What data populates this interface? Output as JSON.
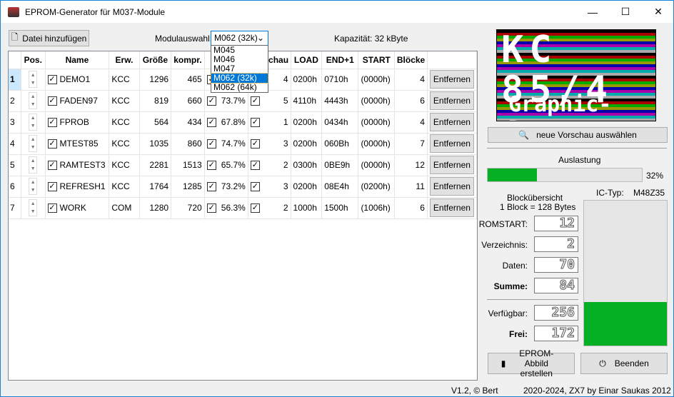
{
  "window": {
    "title": "EPROM-Generator für M037-Module",
    "minimize": "—",
    "maximize": "☐",
    "close": "✕"
  },
  "toolbar": {
    "add_file": "Datei hinzufügen",
    "module_label": "Modulauswahl:",
    "module_value": "M062 (32k)",
    "module_options": [
      "M045",
      "M046",
      "M047",
      "M062 (32k)",
      "M062 (64k)"
    ],
    "capacity": "Kapazität:  32 kByte"
  },
  "table": {
    "headers": [
      "Pos.",
      "Name",
      "Erw.",
      "Größe",
      "kompr.",
      "",
      "Vorschau",
      "LOAD",
      "END+1",
      "START",
      "Blöcke"
    ],
    "rows": [
      {
        "n": "1",
        "name": "DEMO1",
        "ext": "KCC",
        "size": "1296",
        "comp": "465",
        "pct": "",
        "pv": "4",
        "load": "0200h",
        "end": "0710h",
        "start": "(0000h)",
        "blocks": "4"
      },
      {
        "n": "2",
        "name": "FADEN97",
        "ext": "KCC",
        "size": "819",
        "comp": "660",
        "pct": "73.7%",
        "pv": "5",
        "load": "4110h",
        "end": "4443h",
        "start": "(0000h)",
        "blocks": "6"
      },
      {
        "n": "3",
        "name": "FPROB",
        "ext": "KCC",
        "size": "564",
        "comp": "434",
        "pct": "67.8%",
        "pv": "1",
        "load": "0200h",
        "end": "0434h",
        "start": "(0000h)",
        "blocks": "4"
      },
      {
        "n": "4",
        "name": "MTEST85",
        "ext": "KCC",
        "size": "1035",
        "comp": "860",
        "pct": "74.7%",
        "pv": "3",
        "load": "0200h",
        "end": "060Bh",
        "start": "(0000h)",
        "blocks": "7"
      },
      {
        "n": "5",
        "name": "RAMTEST3",
        "ext": "KCC",
        "size": "2281",
        "comp": "1513",
        "pct": "65.7%",
        "pv": "2",
        "load": "0300h",
        "end": "0BE9h",
        "start": "(0000h)",
        "blocks": "12"
      },
      {
        "n": "6",
        "name": "REFRESH1",
        "ext": "KCC",
        "size": "1764",
        "comp": "1285",
        "pct": "73.2%",
        "pv": "3",
        "load": "0200h",
        "end": "08E4h",
        "start": "(0200h)",
        "blocks": "11"
      },
      {
        "n": "7",
        "name": "WORK",
        "ext": "COM",
        "size": "1280",
        "comp": "720",
        "pct": "56.3%",
        "pv": "2",
        "load": "1000h",
        "end": "1500h",
        "start": "(1006h)",
        "blocks": "6"
      }
    ],
    "remove": "Entfernen"
  },
  "preview": {
    "line1": "KC 85/4",
    "line2": "Graphic-Demo",
    "button": "neue Vorschau auswählen"
  },
  "usage": {
    "label": "Auslastung",
    "percent": 32,
    "percent_text": "32%"
  },
  "blocks": {
    "title": "Blockübersicht",
    "subtitle": "1 Block = 128 Bytes",
    "ic_label": "IC-Typ:",
    "ic_value": "M48Z35",
    "romstart_label": "ROMSTART:",
    "romstart": "12",
    "dir_label": "Verzeichnis:",
    "dir": "2",
    "data_label": "Daten:",
    "data": "70",
    "sum_label": "Summe:",
    "sum": "84",
    "avail_label": "Verfügbar:",
    "avail": "256",
    "free_label": "Frei:",
    "free": "172",
    "free_fraction": 0.67
  },
  "buttons": {
    "eprom": "EPROM-Abbild erstellen",
    "quit": "Beenden"
  },
  "footer": {
    "version": "V1.2, © Bert",
    "credit": "2020-2024, ZX7 by Einar Saukas 2012"
  }
}
